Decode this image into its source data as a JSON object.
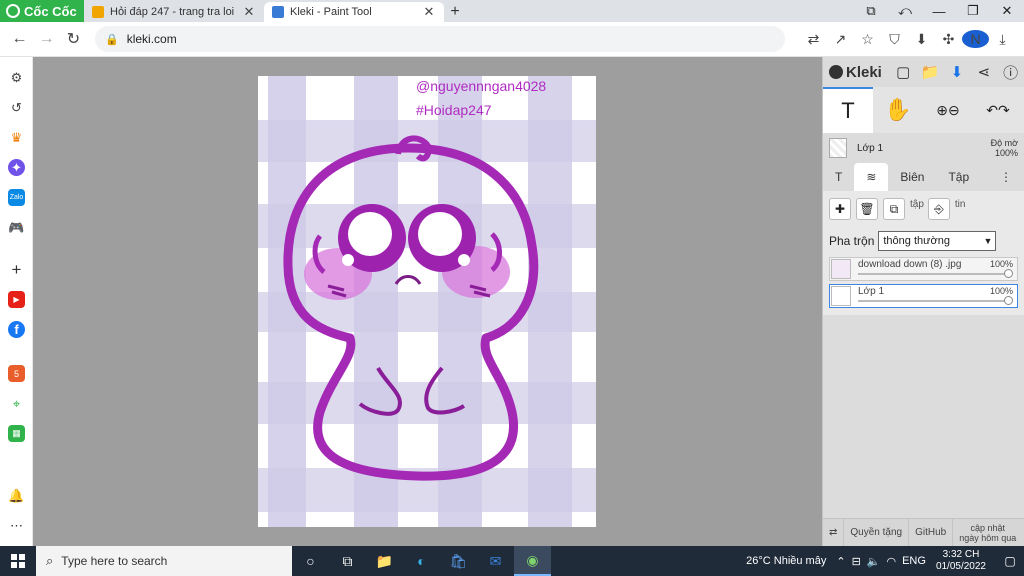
{
  "browser": {
    "brand": "Cốc Cốc",
    "tabs": [
      {
        "title": "Hỏi đáp 247 - trang tra loi",
        "close": "✕",
        "favicon_color": "#f0a500"
      },
      {
        "title": "Kleki - Paint Tool",
        "close": "✕",
        "favicon_color": "#3a7bd5"
      }
    ],
    "new_tab": "+",
    "url": "kleki.com",
    "window_controls": [
      "⧉",
      "⤺",
      "—",
      "❐",
      "✕"
    ],
    "toolbar_icons": [
      "translate-icon",
      "share-icon",
      "bookmark-star-icon",
      "shield-icon",
      "download-icon",
      "extensions-icon",
      "profile-avatar",
      "menu-icon"
    ],
    "avatar_letter": "N"
  },
  "sidebar_icons": [
    "gear-icon",
    "history-icon",
    "crown-icon",
    "messenger-icon",
    "zalo-icon",
    "game-icon",
    "add-icon",
    "youtube-icon",
    "facebook-icon",
    "app-icon",
    "map-icon",
    "sheet-icon",
    "bell-icon",
    "more-icon"
  ],
  "canvas": {
    "watermark_handle": "@nguyennngan4028",
    "watermark_tag": "#Hoidap247"
  },
  "kleki": {
    "logo": "Kleki",
    "layer_name": "Lớp 1",
    "opacity_label": "Độ mờ",
    "opacity_value": "100%",
    "tabs": [
      "Biên",
      "Tập"
    ],
    "layer_btn_label_1": "tập",
    "layer_btn_label_2": "tin",
    "blend_label": "Pha trộn",
    "blend_value": "thông thường",
    "layers": [
      {
        "name": "download down (8) .jpg",
        "opacity": "100%"
      },
      {
        "name": "Lớp 1",
        "opacity": "100%"
      }
    ],
    "footer": {
      "link1": "Quyền tặng",
      "link2": "GitHub",
      "updated_line1": "cập nhật",
      "updated_line2": "ngày hôm qua"
    }
  },
  "taskbar": {
    "search_placeholder": "Type here to search",
    "weather": "26°C  Nhiều mây",
    "lang": "ENG",
    "time": "3:32 CH",
    "date": "01/05/2022"
  }
}
